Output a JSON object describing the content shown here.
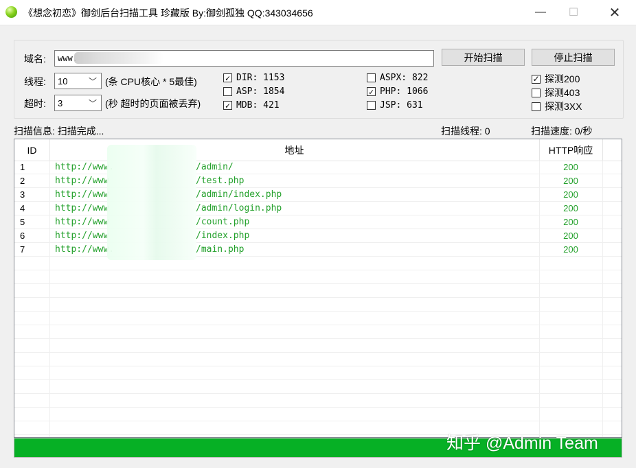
{
  "window": {
    "title": "《想念初恋》御剑后台扫描工具 珍藏版 By:御剑孤独 QQ:343034656",
    "minimize": "—",
    "maximize": "☐",
    "close": "✕"
  },
  "form": {
    "domain_label": "域名:",
    "domain_value": "www.",
    "start_button": "开始扫描",
    "stop_button": "停止扫描",
    "threads_label": "线程:",
    "threads_value": "10",
    "threads_hint": "(条 CPU核心 * 5最佳)",
    "timeout_label": "超时:",
    "timeout_value": "3",
    "timeout_hint": "(秒 超时的页面被丢弃)"
  },
  "dicts": [
    {
      "label": "DIR: 1153",
      "checked": true
    },
    {
      "label": "ASP: 1854",
      "checked": false
    },
    {
      "label": "MDB: 421",
      "checked": true
    },
    {
      "label": "ASPX: 822",
      "checked": false
    },
    {
      "label": "PHP: 1066",
      "checked": true
    },
    {
      "label": "JSP: 631",
      "checked": false
    }
  ],
  "probes": [
    {
      "label": "探测200",
      "checked": true
    },
    {
      "label": "探测403",
      "checked": false
    },
    {
      "label": "探测3XX",
      "checked": false
    }
  ],
  "status": {
    "info": "扫描信息: 扫描完成...",
    "threads": "扫描线程: 0",
    "speed": "扫描速度: 0/秒"
  },
  "table": {
    "columns": [
      "ID",
      "地址",
      "HTTP响应"
    ],
    "rows": [
      {
        "id": "1",
        "url_prefix": "http://www.",
        "url_suffix": "/admin/",
        "code": "200"
      },
      {
        "id": "2",
        "url_prefix": "http://www",
        "url_suffix": "/test.php",
        "code": "200"
      },
      {
        "id": "3",
        "url_prefix": "http://www",
        "url_suffix": "/admin/index.php",
        "code": "200"
      },
      {
        "id": "4",
        "url_prefix": "http://www",
        "url_suffix": "/admin/login.php",
        "code": "200"
      },
      {
        "id": "5",
        "url_prefix": "http://www",
        "url_suffix": "/count.php",
        "code": "200"
      },
      {
        "id": "6",
        "url_prefix": "http://www",
        "url_suffix": "/index.php",
        "code": "200"
      },
      {
        "id": "7",
        "url_prefix": "http://www.",
        "url_suffix": "/main.php",
        "code": "200"
      }
    ]
  },
  "progress": {
    "percent": 100
  },
  "watermark": "知乎 @Admin Team",
  "colors": {
    "accent_green": "#06b025",
    "text_green": "#22a02a"
  }
}
